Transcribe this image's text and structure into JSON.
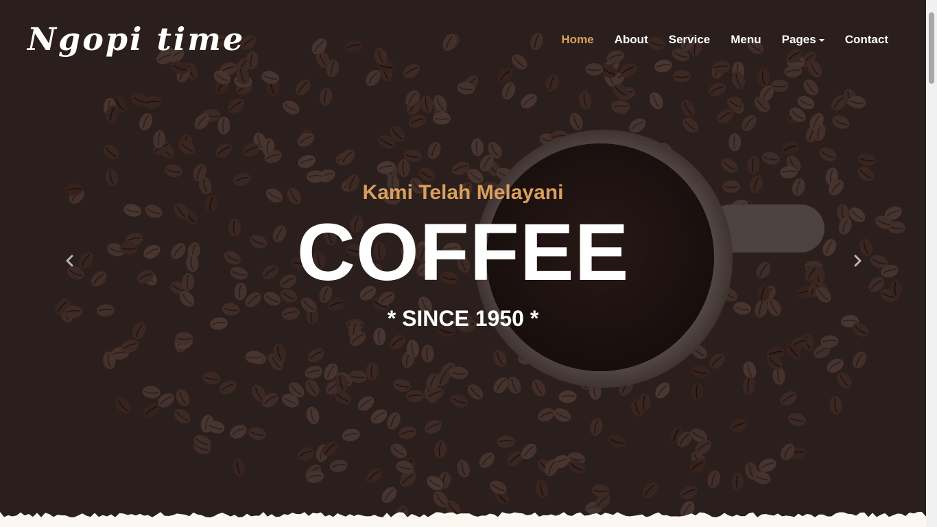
{
  "brand": {
    "name": "Ngopi time"
  },
  "nav": {
    "items": [
      {
        "label": "Home",
        "active": true
      },
      {
        "label": "About",
        "active": false
      },
      {
        "label": "Service",
        "active": false
      },
      {
        "label": "Menu",
        "active": false
      },
      {
        "label": "Pages",
        "active": false,
        "dropdown": true
      },
      {
        "label": "Contact",
        "active": false
      }
    ]
  },
  "hero": {
    "subtitle": "Kami Telah Melayani",
    "title": "COFFEE",
    "since": "* SINCE 1950 *"
  },
  "carousel": {
    "prev_icon": "chevron-left-icon",
    "next_icon": "chevron-right-icon"
  },
  "colors": {
    "accent": "#da9f5b",
    "background_dark": "#2e2320",
    "text_light": "#ffffff",
    "page_light": "#fdf7f1"
  }
}
